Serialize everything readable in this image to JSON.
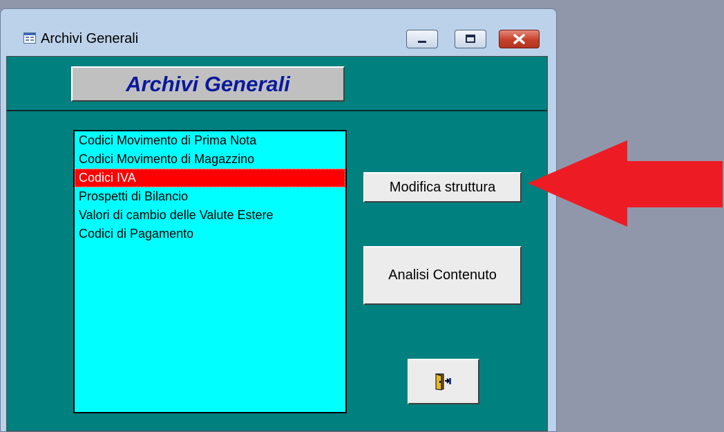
{
  "window": {
    "title": "Archivi Generali",
    "icon": "form-icon"
  },
  "controls": {
    "minimize": "minimize-icon",
    "maximize": "maximize-icon",
    "close": "close-icon"
  },
  "header": {
    "label": "Archivi Generali"
  },
  "list": {
    "items": [
      "Codici Movimento di Prima Nota",
      "Codici Movimento di Magazzino",
      "Codici IVA",
      "Prospetti di Bilancio",
      "Valori di cambio delle Valute Estere",
      "Codici di Pagamento"
    ],
    "selected_index": 2
  },
  "buttons": {
    "modifica_label": "Modifica struttura",
    "analisi_label": "Analisi Contenuto",
    "exit_icon": "exit-door-icon"
  },
  "colors": {
    "client_bg": "#018080",
    "list_bg": "#00ffff",
    "selection": "#ff0000",
    "header_text": "#0a1a9c",
    "arrow": "#ed1c24"
  }
}
